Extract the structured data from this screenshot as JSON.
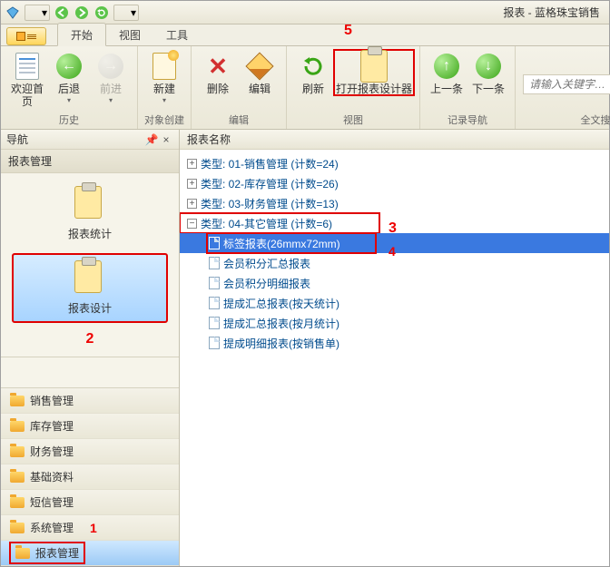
{
  "window": {
    "title": "报表 - 蓝格珠宝销售"
  },
  "tabs": {
    "start": "开始",
    "view": "视图",
    "tools": "工具"
  },
  "ribbon": {
    "history": {
      "label": "历史",
      "home": "欢迎首页",
      "back": "后退",
      "forward": "前进"
    },
    "create": {
      "label": "对象创建",
      "new": "新建"
    },
    "edit": {
      "label": "编辑",
      "delete": "删除",
      "edit": "编辑"
    },
    "viewg": {
      "label": "视图",
      "refresh": "刷新",
      "openDesigner": "打开报表设计器"
    },
    "nav": {
      "label": "记录导航",
      "prev": "上一条",
      "next": "下一条"
    },
    "search": {
      "label": "全文搜索",
      "placeholder": "请输入关键字…"
    }
  },
  "leftPanel": {
    "nav": "导航",
    "section": "报表管理",
    "tile_stats": "报表统计",
    "tile_design": "报表设计",
    "folders": [
      "销售管理",
      "库存管理",
      "财务管理",
      "基础资料",
      "短信管理",
      "系统管理",
      "报表管理"
    ]
  },
  "tree": {
    "header": "报表名称",
    "groups": [
      {
        "label": "类型: 01-销售管理 (计数=24)",
        "expanded": false
      },
      {
        "label": "类型: 02-库存管理 (计数=26)",
        "expanded": false
      },
      {
        "label": "类型: 03-财务管理 (计数=13)",
        "expanded": false
      },
      {
        "label": "类型: 04-其它管理 (计数=6)",
        "expanded": true,
        "items": [
          "标签报表(26mmx72mm)",
          "会员积分汇总报表",
          "会员积分明细报表",
          "提成汇总报表(按天统计)",
          "提成汇总报表(按月统计)",
          "提成明细报表(按销售单)"
        ]
      }
    ]
  },
  "annotations": {
    "a1": "1",
    "a2": "2",
    "a3": "3",
    "a4": "4",
    "a5": "5"
  }
}
